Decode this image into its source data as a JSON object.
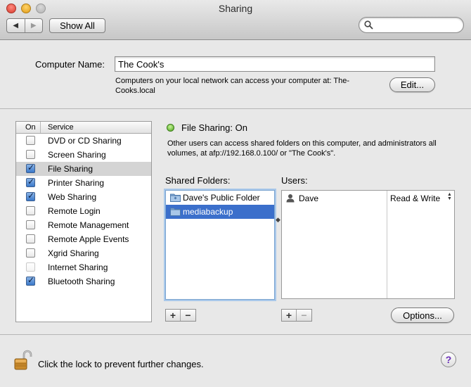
{
  "window": {
    "title": "Sharing",
    "nav_back": "◀",
    "nav_forward": "▶",
    "show_all": "Show All",
    "search_placeholder": ""
  },
  "computer": {
    "label": "Computer Name:",
    "value": "The Cook's",
    "note": "Computers on your local network can access your computer at: The-Cooks.local",
    "edit_button": "Edit..."
  },
  "services": {
    "header_on": "On",
    "header_service": "Service",
    "items": [
      {
        "label": "DVD or CD Sharing",
        "checked": false,
        "disabled": false,
        "selected": false
      },
      {
        "label": "Screen Sharing",
        "checked": false,
        "disabled": false,
        "selected": false
      },
      {
        "label": "File Sharing",
        "checked": true,
        "disabled": false,
        "selected": true
      },
      {
        "label": "Printer Sharing",
        "checked": true,
        "disabled": false,
        "selected": false
      },
      {
        "label": "Web Sharing",
        "checked": true,
        "disabled": false,
        "selected": false
      },
      {
        "label": "Remote Login",
        "checked": false,
        "disabled": false,
        "selected": false
      },
      {
        "label": "Remote Management",
        "checked": false,
        "disabled": false,
        "selected": false
      },
      {
        "label": "Remote Apple Events",
        "checked": false,
        "disabled": false,
        "selected": false
      },
      {
        "label": "Xgrid Sharing",
        "checked": false,
        "disabled": false,
        "selected": false
      },
      {
        "label": "Internet Sharing",
        "checked": false,
        "disabled": true,
        "selected": false
      },
      {
        "label": "Bluetooth Sharing",
        "checked": true,
        "disabled": false,
        "selected": false
      }
    ]
  },
  "file_sharing": {
    "status": "File Sharing: On",
    "status_color": "#4aa31a",
    "description": "Other users can access shared folders on this computer, and administrators all volumes, at afp://192.168.0.100/ or \"The Cook's\".",
    "shared_folders_label": "Shared Folders:",
    "users_label": "Users:",
    "folders": [
      {
        "name": "Dave's Public Folder",
        "icon": "public-folder-icon",
        "selected": false
      },
      {
        "name": "mediabackup",
        "icon": "folder-icon",
        "selected": true
      }
    ],
    "users": [
      {
        "name": "Dave",
        "permission": "Read & Write",
        "icon": "user-icon"
      }
    ],
    "add_label": "+",
    "remove_label": "−",
    "options_button": "Options..."
  },
  "footer": {
    "lock_text": "Click the lock to prevent further changes.",
    "help_label": "?"
  },
  "colors": {
    "selection_blue": "#3b6fcb",
    "help_purple": "#6a2fb8"
  }
}
